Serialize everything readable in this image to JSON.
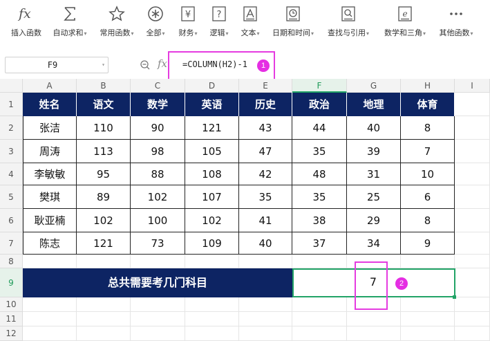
{
  "ribbon": {
    "buttons": [
      {
        "label": "插入函数",
        "icon": "fx-icon",
        "dropdown": false
      },
      {
        "label": "自动求和",
        "icon": "sigma-icon",
        "dropdown": true
      },
      {
        "label": "常用函数",
        "icon": "star-icon",
        "dropdown": true
      },
      {
        "label": "全部",
        "icon": "asterisk-icon",
        "dropdown": true
      },
      {
        "label": "财务",
        "icon": "yen-icon",
        "dropdown": true
      },
      {
        "label": "逻辑",
        "icon": "question-icon",
        "dropdown": true
      },
      {
        "label": "文本",
        "icon": "text-a-icon",
        "dropdown": true
      },
      {
        "label": "日期和时间",
        "icon": "clock-icon",
        "dropdown": true
      },
      {
        "label": "查找与引用",
        "icon": "lookup-icon",
        "dropdown": true
      },
      {
        "label": "数学和三角",
        "icon": "math-icon",
        "dropdown": true
      },
      {
        "label": "其他函数",
        "icon": "more-icon",
        "dropdown": true
      }
    ]
  },
  "formula_bar": {
    "name_box": "F9",
    "formula": "=COLUMN(H2)-1"
  },
  "annotations": {
    "badge1": "1",
    "badge2": "2"
  },
  "columns": [
    "A",
    "B",
    "C",
    "D",
    "E",
    "F",
    "G",
    "H",
    "I"
  ],
  "rows": [
    "1",
    "2",
    "3",
    "4",
    "5",
    "6",
    "7",
    "8",
    "9",
    "10",
    "11",
    "12"
  ],
  "table": {
    "headers": [
      "姓名",
      "语文",
      "数学",
      "英语",
      "历史",
      "政治",
      "地理",
      "体育"
    ],
    "rows": [
      [
        "张洁",
        "110",
        "90",
        "121",
        "43",
        "44",
        "40",
        "8"
      ],
      [
        "周涛",
        "113",
        "98",
        "105",
        "47",
        "35",
        "39",
        "7"
      ],
      [
        "李敏敏",
        "95",
        "88",
        "108",
        "42",
        "48",
        "31",
        "10"
      ],
      [
        "樊琪",
        "89",
        "102",
        "107",
        "35",
        "35",
        "25",
        "6"
      ],
      [
        "耿亚楠",
        "102",
        "100",
        "102",
        "41",
        "38",
        "29",
        "8"
      ],
      [
        "陈志",
        "121",
        "73",
        "109",
        "40",
        "37",
        "34",
        "9"
      ]
    ]
  },
  "summary": {
    "label": "总共需要考几门科目",
    "value": "7"
  },
  "colors": {
    "header_bg": "#0d2463",
    "highlight": "#e53be0",
    "selection": "#21a366"
  }
}
